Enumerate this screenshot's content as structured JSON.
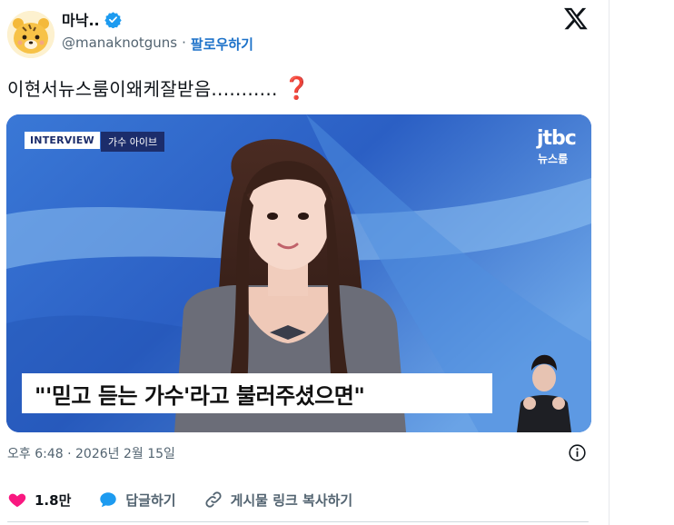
{
  "author": {
    "display_name": "마낙..",
    "handle": "@manaknotguns",
    "separator": "·",
    "follow_label": "팔로우하기",
    "verified_icon": "verified-badge-icon"
  },
  "tweet": {
    "text": "이현서뉴스룸이왜케잘받음...........",
    "emoji_icon": "red-question-mark-icon"
  },
  "media": {
    "tag_primary": "INTERVIEW",
    "tag_secondary": "가수 아이브",
    "broadcaster_logo": "jtbc",
    "broadcaster_program": "뉴스룸",
    "caption": "\"'믿고 듣는 가수'라고 불러주셨으면\""
  },
  "meta": {
    "timestamp": "오후 6:48 · 2026년 2월 15일"
  },
  "actions": {
    "like_count": "1.8만",
    "reply_label": "답글하기",
    "copy_link_label": "게시물 링크 복사하기"
  },
  "colors": {
    "accent": "#1d9bf0",
    "like": "#f91880",
    "follow": "#1d72c9",
    "muted": "#536471"
  }
}
